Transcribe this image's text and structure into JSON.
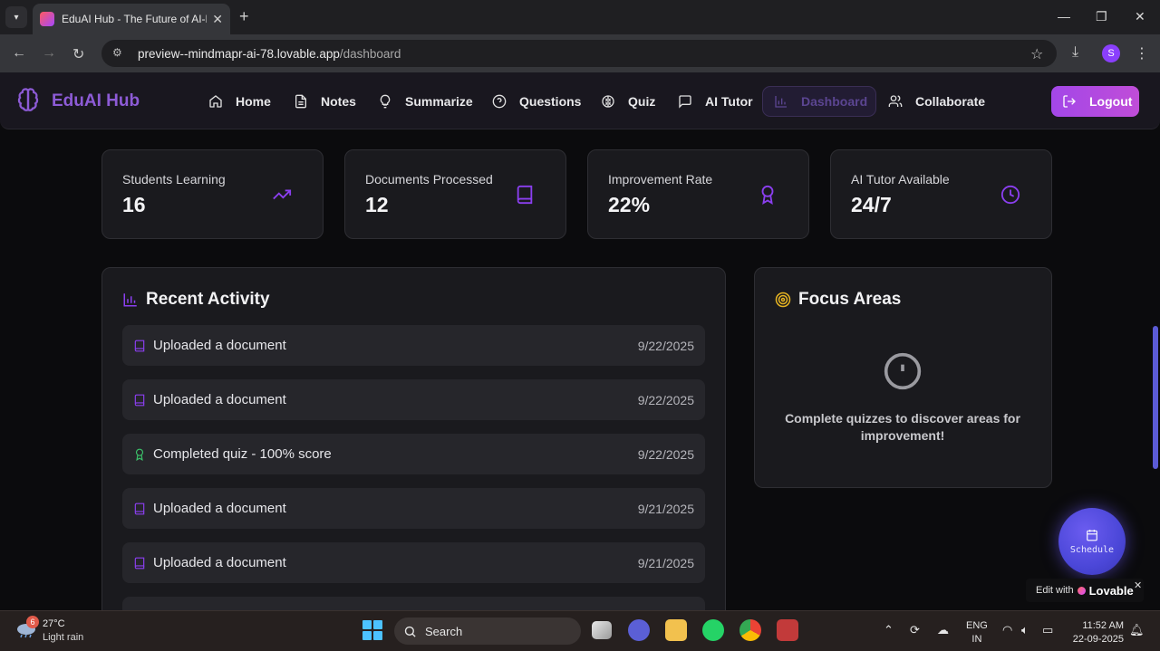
{
  "browser": {
    "tab_title": "EduAI Hub - The Future of AI-P",
    "url_host": "preview--mindmapr-ai-78.lovable.app",
    "url_path": "/dashboard",
    "profile_initial": "S"
  },
  "nav": {
    "brand": "EduAI Hub",
    "items": [
      {
        "label": "Home",
        "icon": "home-icon"
      },
      {
        "label": "Notes",
        "icon": "file-text-icon"
      },
      {
        "label": "Summarize",
        "icon": "lightbulb-icon"
      },
      {
        "label": "Questions",
        "icon": "help-circle-icon"
      },
      {
        "label": "Quiz",
        "icon": "brain-icon"
      },
      {
        "label": "AI Tutor",
        "icon": "message-square-icon"
      },
      {
        "label": "Dashboard",
        "icon": "bar-chart-icon",
        "active": true
      },
      {
        "label": "Collaborate",
        "icon": "users-icon"
      }
    ],
    "logout_label": "Logout"
  },
  "stats": [
    {
      "label": "Students Learning",
      "value": "16",
      "icon": "trending-up-icon"
    },
    {
      "label": "Documents Processed",
      "value": "12",
      "icon": "book-icon"
    },
    {
      "label": "Improvement Rate",
      "value": "22%",
      "icon": "award-icon"
    },
    {
      "label": "AI Tutor Available",
      "value": "24/7",
      "icon": "clock-icon"
    }
  ],
  "recent_activity": {
    "title": "Recent Activity",
    "items": [
      {
        "text": "Uploaded a document",
        "date": "9/22/2025",
        "icon": "book-icon"
      },
      {
        "text": "Uploaded a document",
        "date": "9/22/2025",
        "icon": "book-icon"
      },
      {
        "text": "Completed quiz - 100% score",
        "date": "9/22/2025",
        "icon": "award-icon"
      },
      {
        "text": "Uploaded a document",
        "date": "9/21/2025",
        "icon": "book-icon"
      },
      {
        "text": "Uploaded a document",
        "date": "9/21/2025",
        "icon": "book-icon"
      }
    ]
  },
  "focus_areas": {
    "title": "Focus Areas",
    "empty_message": "Complete quizzes to discover areas for improvement!"
  },
  "schedule_label": "Schedule",
  "lovable_badge": {
    "prefix": "Edit with",
    "brand": "Lovable"
  },
  "taskbar": {
    "weather_badge": "6",
    "temperature": "27°C",
    "condition": "Light rain",
    "search_label": "Search",
    "lang_line1": "ENG",
    "lang_line2": "IN",
    "time": "11:52 AM",
    "date": "22-09-2025"
  },
  "colors": {
    "accent": "#8b3ff0",
    "brand_text": "#8d5bd6",
    "logout_gradient_start": "#a347e8",
    "success": "#3bc26a",
    "focus_icon": "#e6b422"
  }
}
